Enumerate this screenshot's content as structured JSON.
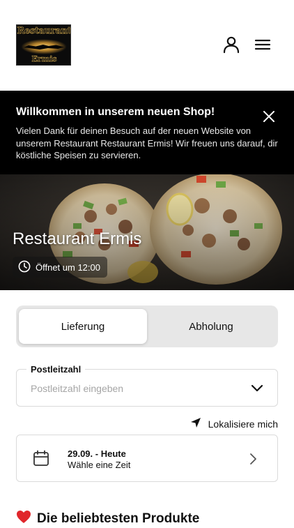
{
  "header": {
    "logo_text_line1": "Restaurant",
    "logo_text_line2": "Ermis",
    "account_icon": "user-icon",
    "menu_icon": "hamburger-menu-icon"
  },
  "banner": {
    "title": "Willkommen in unserem neuen Shop!",
    "text": "Vielen Dank für deinen Besuch auf der neuen Website von unserem Restaurant Restaurant Ermis! Wir freuen uns darauf, dir köstliche Speisen zu servieren.",
    "close_icon": "close-icon"
  },
  "hero": {
    "restaurant_name": "Restaurant Ermis",
    "opening_text": "Öffnet um 12:00",
    "clock_icon": "clock-icon"
  },
  "order_mode": {
    "options": [
      "Lieferung",
      "Abholung"
    ],
    "selected": "Lieferung"
  },
  "zip": {
    "label": "Postleitzahl",
    "placeholder": "Postleitzahl eingeben",
    "value": ""
  },
  "locate": {
    "label": "Lokalisiere mich",
    "icon": "location-arrow-icon"
  },
  "date": {
    "main": "29.09. - Heute",
    "sub": "Wähle eine Zeit",
    "icon": "calendar-icon"
  },
  "popular": {
    "title": "Die beliebtesten Produkte",
    "icon": "heart-icon"
  },
  "colors": {
    "banner_bg": "#000000",
    "toggle_bg": "#e7e7e7",
    "heart": "#e0262b"
  }
}
